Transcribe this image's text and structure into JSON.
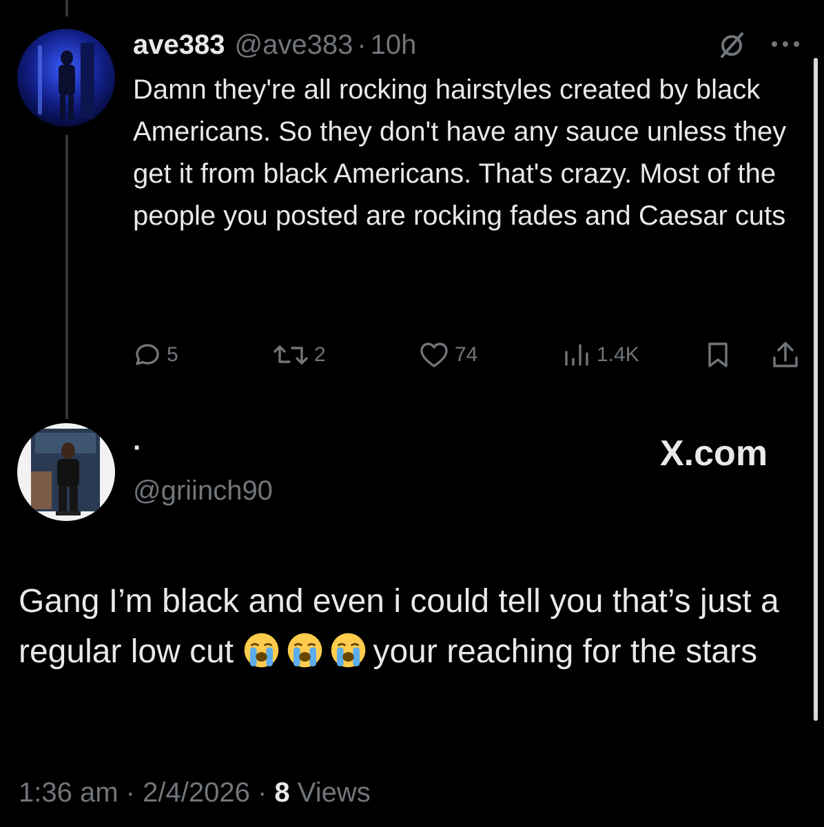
{
  "tweet": {
    "name": "ave383",
    "handle": "@ave383",
    "separator": "·",
    "time": "10h",
    "text": "Damn they're all rocking hairstyles created by black Americans. So they don't have any sauce unless they get it from black Americans. That's crazy. Most of the people you posted are rocking fades and Caesar cuts",
    "header_icons": [
      "grok-slash-icon",
      "more-dots-icon"
    ],
    "actions": {
      "replies": "5",
      "reposts": "2",
      "likes": "74",
      "views": "1.4K"
    }
  },
  "reply": {
    "name": "·",
    "handle": "@griinch90",
    "watermark": "X.com",
    "text_part1": "Gang I’m black and even i could tell you that’s just a regular low cut ",
    "text_part2": "your reaching for the stars",
    "emojis": [
      "loudly-crying-face",
      "loudly-crying-face",
      "loudly-crying-face"
    ],
    "footer": {
      "time": "1:36 am",
      "sep": "·",
      "date": "2/4/2026",
      "views_count": "8",
      "views_label": "Views"
    }
  },
  "colors": {
    "background": "#000000",
    "primary_text": "#e7e9ea",
    "secondary_text": "#71767b",
    "thread_line": "#333639"
  }
}
